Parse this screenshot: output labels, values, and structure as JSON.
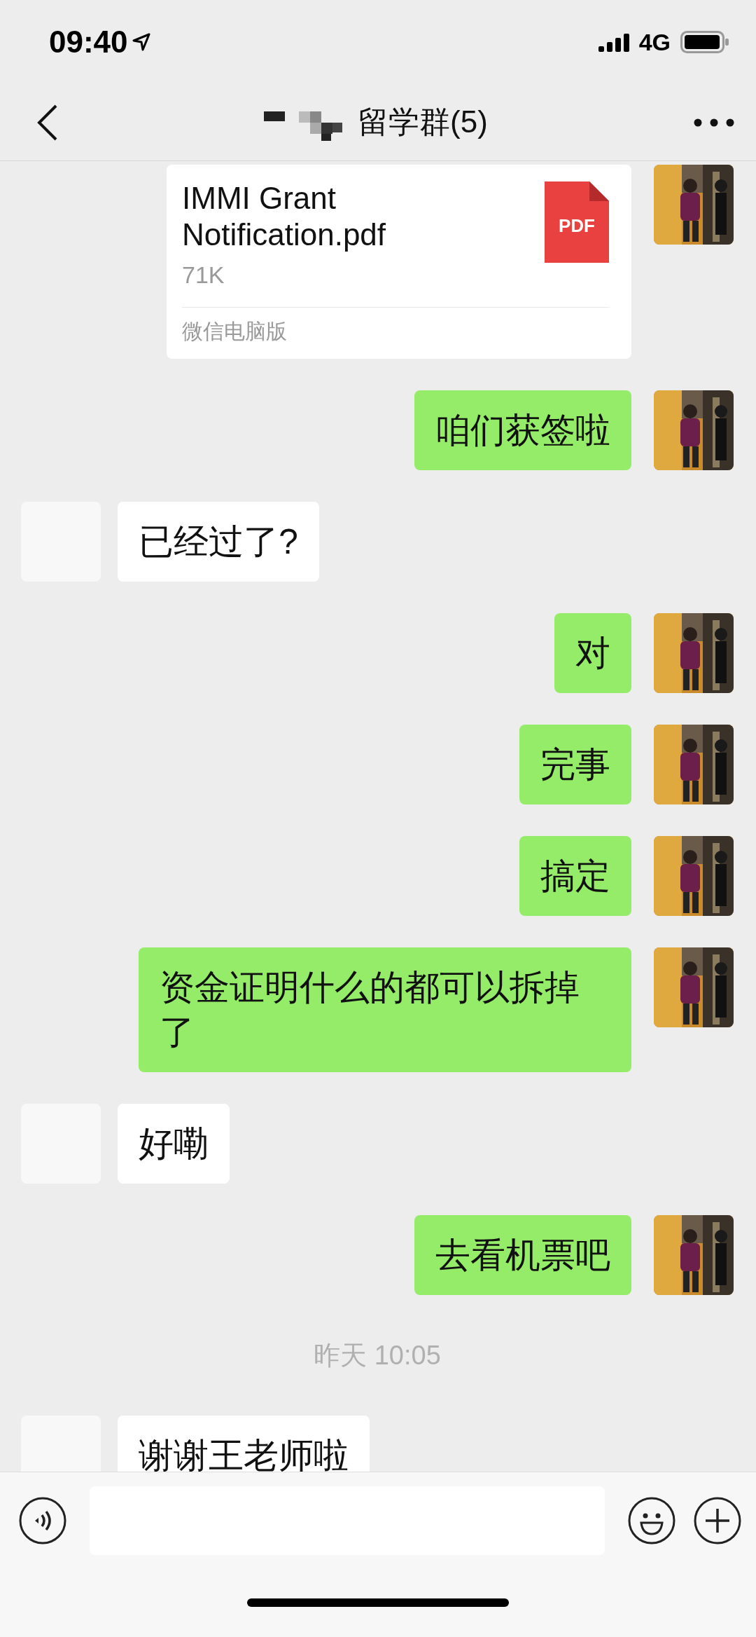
{
  "status_bar": {
    "time": "09:40",
    "network": "4G"
  },
  "nav_bar": {
    "title": "留学群(5)"
  },
  "messages": [
    {
      "kind": "file",
      "outgoing": true,
      "file_name": "IMMI Grant Notification.pdf",
      "file_size": "71K",
      "file_type": "PDF",
      "source": "微信电脑版"
    },
    {
      "kind": "text",
      "outgoing": true,
      "text": "咱们获签啦"
    },
    {
      "kind": "text",
      "outgoing": false,
      "text": "已经过了?"
    },
    {
      "kind": "text",
      "outgoing": true,
      "text": "对"
    },
    {
      "kind": "text",
      "outgoing": true,
      "text": "完事"
    },
    {
      "kind": "text",
      "outgoing": true,
      "text": "搞定"
    },
    {
      "kind": "text",
      "outgoing": true,
      "text": "资金证明什么的都可以拆掉了"
    },
    {
      "kind": "text",
      "outgoing": false,
      "text": "好嘞"
    },
    {
      "kind": "text",
      "outgoing": true,
      "text": "去看机票吧"
    },
    {
      "kind": "time",
      "text": "昨天 10:05"
    },
    {
      "kind": "text",
      "outgoing": false,
      "text": "谢谢王老师啦"
    }
  ]
}
